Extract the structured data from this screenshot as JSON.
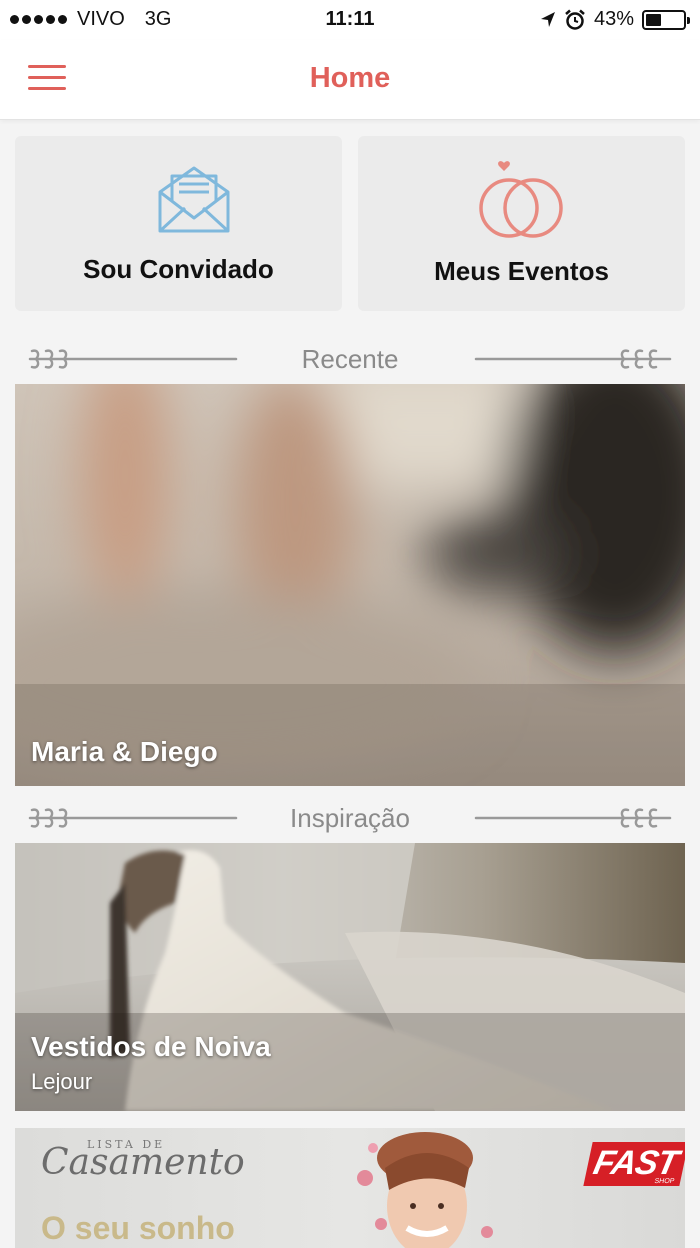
{
  "status_bar": {
    "carrier": "VIVO",
    "network": "3G",
    "time": "11:11",
    "battery": "43%",
    "battery_level": 0.43
  },
  "nav": {
    "title": "Home",
    "menu_icon": "hamburger-icon",
    "accent_color": "#e0605a"
  },
  "actions": [
    {
      "label": "Sou Convidado",
      "icon": "envelope-icon",
      "icon_color": "#7fb8dc"
    },
    {
      "label": "Meus Eventos",
      "icon": "rings-icon",
      "icon_color": "#e88a80"
    }
  ],
  "sections": {
    "recent": {
      "title": "Recente"
    },
    "inspiration": {
      "title": "Inspiração"
    }
  },
  "recent_event": {
    "title": "Maria & Diego"
  },
  "inspiration_item": {
    "title": "Vestidos de Noiva",
    "subtitle": "Lejour"
  },
  "ad": {
    "brand_script_small": "LISTA DE",
    "brand_script": "Casamento",
    "headline": "O seu sonho",
    "store_logo": "FAST",
    "store_logo_sub": "SHOP"
  }
}
